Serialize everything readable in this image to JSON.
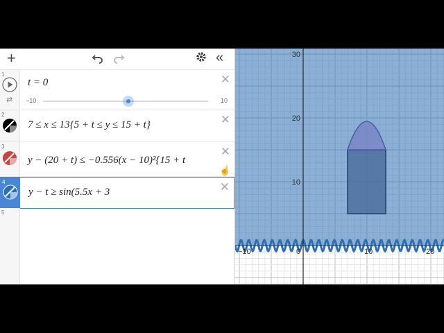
{
  "toolbar": {
    "add_icon": "plus-icon",
    "undo_icon": "undo-icon",
    "redo_icon": "redo-icon",
    "settings_icon": "gear-icon",
    "collapse_icon": "double-chevron-left-icon"
  },
  "expressions": [
    {
      "index": "1",
      "text": "t = 0",
      "slider_min": "−10",
      "slider_max": "10",
      "slider_value": 0
    },
    {
      "index": "2",
      "text": "7 ≤ x ≤ 13{5 + t ≤ y ≤ 15 + t}",
      "color": "#000000"
    },
    {
      "index": "3",
      "text": "y − (20 + t) ≤ −0.556(x − 10)²{15 + t",
      "color": "#c74440"
    },
    {
      "index": "4",
      "text": "y − t ≥ sin(5.5x + 3",
      "color": "#2d70b3"
    },
    {
      "index": "5",
      "text": ""
    }
  ],
  "graph": {
    "x_ticks": [
      "−10",
      "0",
      "10",
      "20"
    ],
    "y_ticks": [
      "10",
      "20",
      "30"
    ],
    "shade_color": "#2d70b3",
    "house_color": "#6a7fb8"
  }
}
